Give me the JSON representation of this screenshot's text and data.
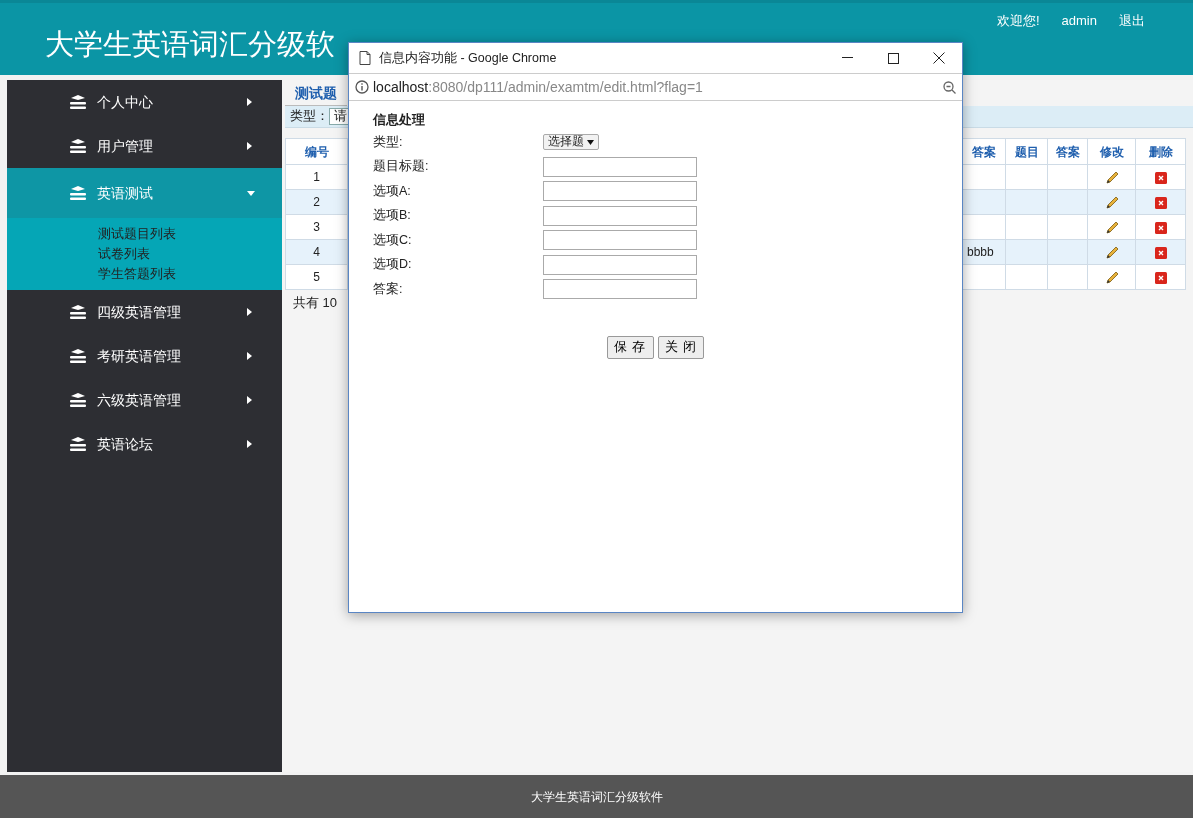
{
  "header": {
    "title": "大学生英语词汇分级软",
    "welcome": "欢迎您!",
    "user": "admin",
    "logout": "退出"
  },
  "sidebar": {
    "items": [
      {
        "label": "个人中心",
        "expanded": false
      },
      {
        "label": "用户管理",
        "expanded": false
      },
      {
        "label": "英语测试",
        "expanded": true,
        "children": [
          {
            "label": "测试题目列表"
          },
          {
            "label": "试卷列表"
          },
          {
            "label": "学生答题列表"
          }
        ]
      },
      {
        "label": "四级英语管理",
        "expanded": false
      },
      {
        "label": "考研英语管理",
        "expanded": false
      },
      {
        "label": "六级英语管理",
        "expanded": false
      },
      {
        "label": "英语论坛",
        "expanded": false
      }
    ]
  },
  "main": {
    "title": "测试题",
    "filter": {
      "label": "类型：",
      "value": "请"
    },
    "table": {
      "columns": [
        "编号",
        "答案",
        "题目",
        "答案",
        "修改",
        "删除"
      ],
      "rows": [
        {
          "number": "1"
        },
        {
          "number": "2"
        },
        {
          "number": "3"
        },
        {
          "number": "4",
          "answer": "bbbb"
        },
        {
          "number": "5"
        }
      ]
    },
    "total": "共有 10"
  },
  "popup": {
    "title": "信息内容功能 - Google Chrome",
    "url_host": "localhost",
    "url_rest": ":8080/dp111/admin/examtm/edit.html?flag=1",
    "heading": "信息处理",
    "fields": [
      {
        "label": "类型:",
        "kind": "select",
        "value": "选择题"
      },
      {
        "label": "题目标题:",
        "kind": "text"
      },
      {
        "label": "选项A:",
        "kind": "text"
      },
      {
        "label": "选项B:",
        "kind": "text"
      },
      {
        "label": "选项C:",
        "kind": "text"
      },
      {
        "label": "选项D:",
        "kind": "text"
      },
      {
        "label": "答案:",
        "kind": "text"
      }
    ],
    "buttons": [
      "保 存",
      "关 闭"
    ]
  },
  "footer": {
    "text": "大学生英语词汇分级软件"
  }
}
